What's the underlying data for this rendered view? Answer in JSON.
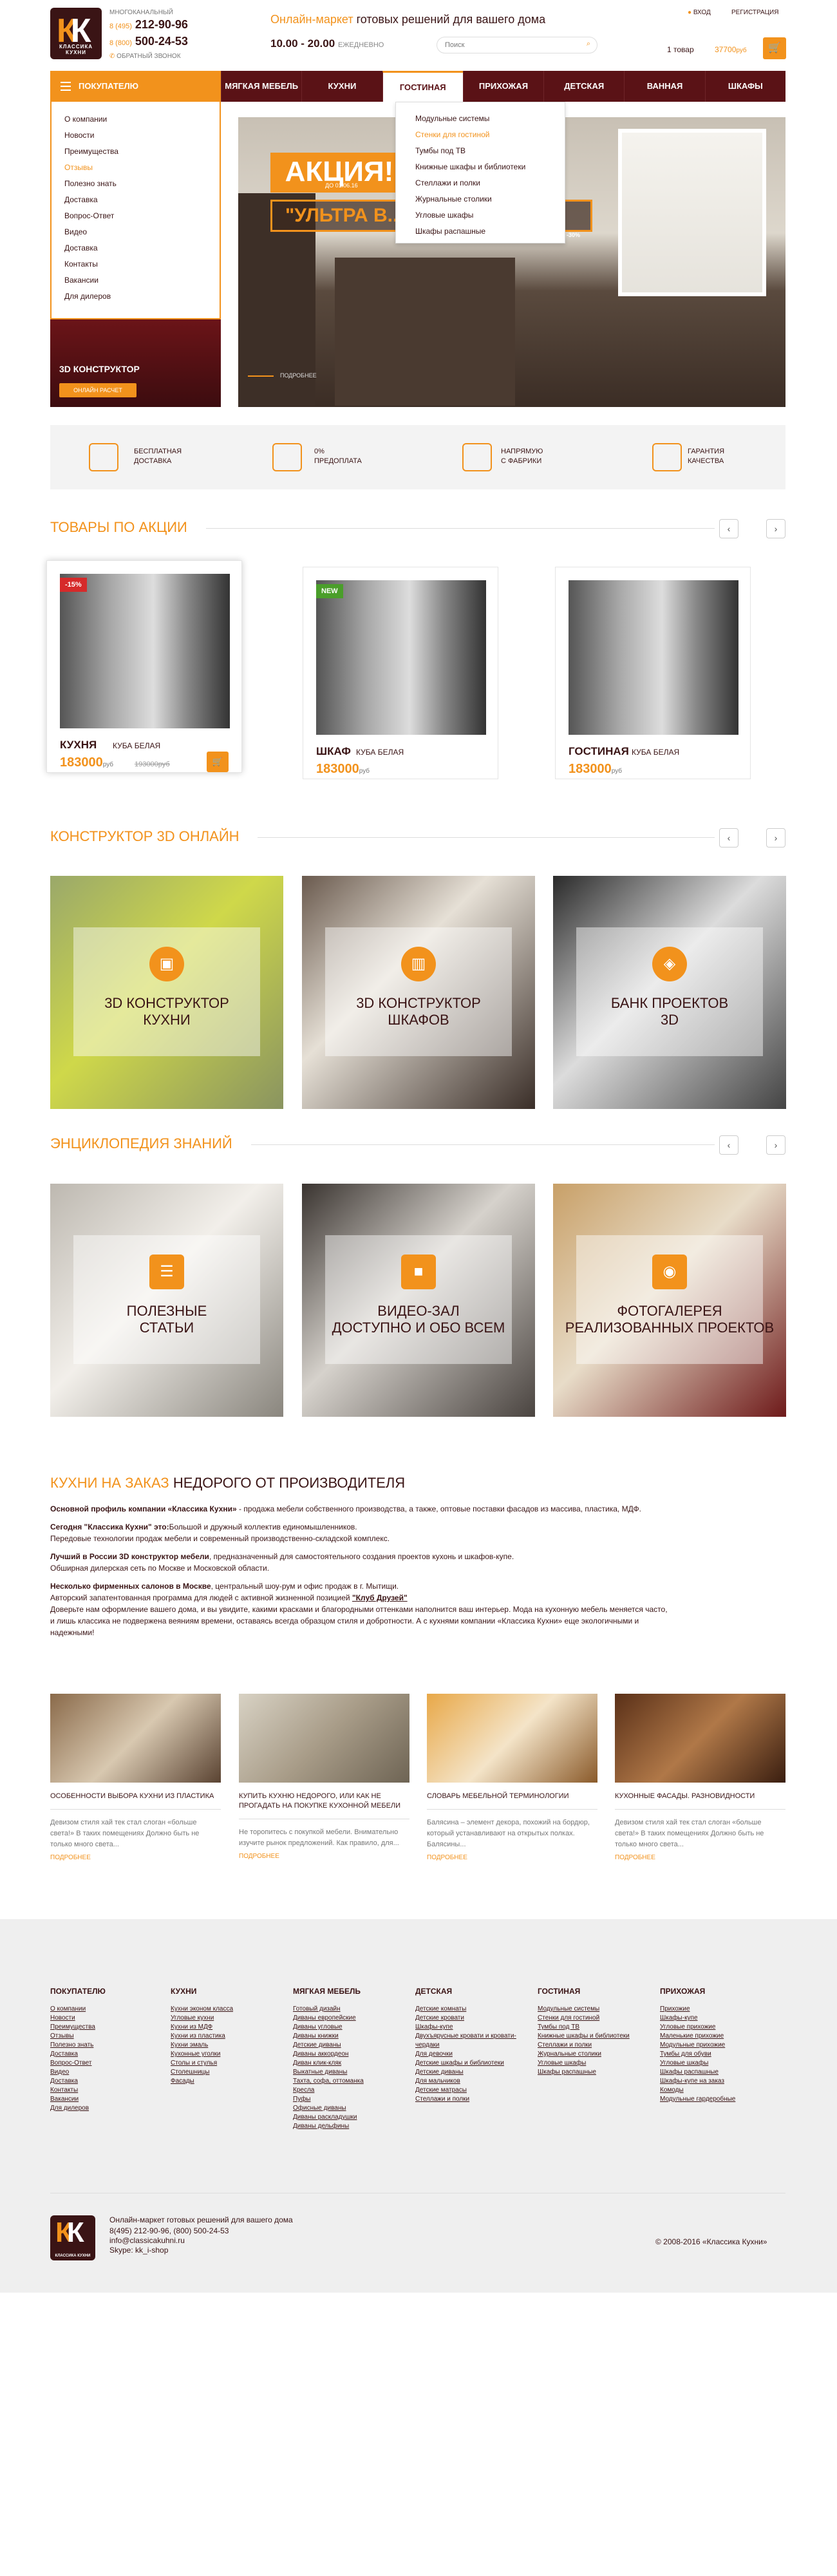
{
  "header": {
    "logo_letters": "К",
    "logo_text": "КЛАССИКА КУХНИ",
    "phone_caption": "МНОГОКАНАЛЬНЫЙ",
    "phone1_prefix": "8 (495)",
    "phone1": "212-90-96",
    "phone2_prefix": "8 (800)",
    "phone2": "500-24-53",
    "callback": "ОБРАТНЫЙ ЗВОНОК",
    "tagline_or": "Онлайн-маркет",
    "tagline_rest": " готовых решений для вашего дома",
    "hours": "10.00 - 20.00",
    "hours_suffix": "ЕЖЕДНЕВНО",
    "search_placeholder": "Поиск",
    "login": "ВХОД",
    "register": "РЕГИСТРАЦИЯ",
    "cart_count": "1 товар",
    "cart_sum": "37700",
    "cart_currency": "руб"
  },
  "nav": {
    "catalog": "ПОКУПАТЕЛЮ",
    "items": [
      "МЯГКАЯ МЕБЕЛЬ",
      "КУХНИ",
      "ГОСТИНАЯ",
      "ПРИХОЖАЯ",
      "ДЕТСКАЯ",
      "ВАННАЯ",
      "ШКАФЫ"
    ]
  },
  "sidemenu": [
    "О компании",
    "Новости",
    "Преимущества",
    "Отзывы",
    "Полезно знать",
    "Доставка",
    "Вопрос-Ответ",
    "Видео",
    "Доставка",
    "Контакты",
    "Вакансии",
    "Для дилеров"
  ],
  "dropdown": [
    "Модульные системы",
    "Стенки для гостиной",
    "Тумбы под ТВ",
    "Книжные шкафы и библиотеки",
    "Стеллажи и полки",
    "Журнальные столики",
    "Угловые шкафы",
    "Шкафы распашные"
  ],
  "hero": {
    "akcia": "АКЦИЯ!",
    "akcia_date": "ДО 01.06.16",
    "ultra": "\"УЛЬТРА В... ...О\"",
    "percent": "-30%",
    "more": "ПОДРОБНЕЕ",
    "constructor": "3D КОНСТРУКТОР",
    "constructor_btn": "ОНЛАЙН РАСЧЕТ"
  },
  "features": [
    {
      "l1": "БЕСПЛАТНАЯ",
      "l2": "ДОСТАВКА"
    },
    {
      "l1": "0%",
      "l2": "ПРЕДОПЛАТА"
    },
    {
      "l1": "НАПРЯМУЮ",
      "l2": "С ФАБРИКИ"
    },
    {
      "l1": "ГАРАНТИЯ",
      "l2": "КАЧЕСТВА"
    }
  ],
  "promo": {
    "title": "ТОВАРЫ ПО АКЦИИ",
    "products": [
      {
        "badge": "-15%",
        "badge_color": "#d62a2a",
        "name": "КУХНЯ",
        "sub": "КУБА БЕЛАЯ",
        "price": "183000",
        "old": "193000руб"
      },
      {
        "badge": "NEW",
        "badge_color": "#4a9e2a",
        "name": "ШКАФ",
        "sub": "КУБА БЕЛАЯ",
        "price": "183000",
        "old": ""
      },
      {
        "badge": "",
        "badge_color": "",
        "name": "ГОСТИНАЯ",
        "sub": "КУБА БЕЛАЯ",
        "price": "183000",
        "old": ""
      }
    ],
    "currency": "руб"
  },
  "constructor": {
    "title": "КОНСТРУКТОР 3D ОНЛАЙН",
    "tiles": [
      {
        "l1": "3D КОНСТРУКТОР",
        "l2": "КУХНИ"
      },
      {
        "l1": "3D КОНСТРУКТОР",
        "l2": "ШКАФОВ"
      },
      {
        "l1": "БАНК ПРОЕКТОВ",
        "l2": "3D"
      }
    ]
  },
  "encyclopedia": {
    "title": "ЭНЦИКЛОПЕДИЯ ЗНАНИЙ",
    "tiles": [
      {
        "l1": "ПОЛЕЗНЫЕ",
        "l2": "СТАТЬИ"
      },
      {
        "l1": "ВИДЕО-ЗАЛ",
        "l2": "Доступно и обо всем"
      },
      {
        "l1": "ФОТОГАЛЕРЕЯ",
        "l2": "реализованных проектов"
      }
    ]
  },
  "about": {
    "title_or": "КУХНИ НА ЗАКАЗ",
    "title_rest": " НЕДОРОГО ОТ ПРОИЗВОДИТЕЛЯ",
    "p1b": "Основной профиль компании «Классика Кухни»",
    "p1": " - продажа мебели собственного производства, а также, оптовые поставки фасадов из массива, пластика, МДФ.",
    "p2b": "Сегодня \"Классика Кухни\" это:",
    "p2": "Большой и дружный коллектив единомышленников.",
    "p3": "Передовые технологии продаж мебели и современный производственно-складской комплекс.",
    "p4b": "Лучший в России 3D конструктор мебели",
    "p4": ", предназначенный для самостоятельного создания проектов кухонь и шкафов-купе.",
    "p5": "Обширная дилерская сеть по Москве и Московской области.",
    "p6b": "Несколько фирменных салонов в Москве",
    "p6": ", центральный шоу-рум и офис продаж в г. Мытищи.",
    "p7": "Авторский запатентованная программа для людей с активной жизненной позицией ",
    "p7b": "\"Клуб Друзей\"",
    "p8": "Доверьте нам оформление вашего дома, и вы увидите, какими красками и благородными оттенками наполнится ваш интерьер. Мода на кухонную мебель меняется часто,",
    "p9": "и лишь классика не подвержена веяниям времени, оставаясь всегда образцом стиля и добротности. А с кухнями компании «Классика Кухни» еще экологичными и",
    "p10": "надежными!"
  },
  "articles": [
    {
      "title": "ОСОБЕННОСТИ ВЫБОРА КУХНИ ИЗ ПЛАСТИКА",
      "desc": "Девизом стиля хай тек стал слоган «больше света!» В таких помещениях Должно быть не только много света...",
      "more": "ПОДРОБНЕЕ"
    },
    {
      "title": "КУПИТЬ КУХНЮ НЕДОРОГО, ИЛИ КАК НЕ ПРОГАДАТЬ НА ПОКУПКЕ КУХОННОЙ МЕБЕЛИ",
      "desc": "Не торопитесь с покупкой мебели. Внимательно изучите рынок предложений. Как правило, для...",
      "more": "ПОДРОБНЕЕ"
    },
    {
      "title": "СЛОВАРЬ МЕБЕЛЬНОЙ ТЕРМИНОЛОГИИ",
      "desc": "Балясина – элемент декора, похожий на бордюр, который устанавливают на открытых полках. Балясины...",
      "more": "ПОДРОБНЕЕ"
    },
    {
      "title": "КУХОННЫЕ ФАСАДЫ. РАЗНОВИДНОСТИ",
      "desc": "Девизом стиля хай тек стал слоган «больше света!» В таких помещениях Должно быть не только много света...",
      "more": "ПОДРОБНЕЕ"
    }
  ],
  "footer": {
    "cols": [
      {
        "h": "ПОКУПАТЕЛЮ",
        "items": [
          "О компании",
          "Новости",
          "Преимущества",
          "Отзывы",
          "Полезно знать",
          "Доставка",
          "Вопрос-Ответ",
          "Видео",
          "Доставка",
          "Контакты",
          "Вакансии",
          "Для дилеров"
        ]
      },
      {
        "h": "КУХНИ",
        "items": [
          "Кухни эконом класса",
          "Угловые кухни",
          "Кухни из МДФ",
          "Кухни из пластика",
          "Кухни эмаль",
          "Кухонные уголки",
          "Столы и стулья",
          "Столешницы",
          "Фасады"
        ]
      },
      {
        "h": "МЯГКАЯ МЕБЕЛЬ",
        "items": [
          "Готовый дизайн",
          "Диваны европейские",
          "Диваны угловые",
          "Диваны книжки",
          "Детские диваны",
          "Диваны аккордеон",
          "Диван клик-кляк",
          "Выкатные диваны",
          "Тахта, софа, оттоманка",
          "Кресла",
          "Пуфы",
          "Офисные диваны",
          "Диваны раскладушки",
          "Диваны дельфины"
        ]
      },
      {
        "h": "ДЕТСКАЯ",
        "items": [
          "Детские комнаты",
          "Детские кровати",
          "Шкафы-купе",
          "Двухъярусные кровати и кровати-чердаки",
          "Для девочки",
          "Детские шкафы и библиотеки",
          "Детские диваны",
          "Для мальчиков",
          "Детские матрасы",
          "Стеллажи и полки"
        ]
      },
      {
        "h": "ГОСТИНАЯ",
        "items": [
          "Модульные системы",
          "Стенки для гостиной",
          "Тумбы под ТВ",
          "Книжные шкафы и библиотеки",
          "Стеллажи и полки",
          "Журнальные столики",
          "Угловые шкафы",
          "Шкафы распашные"
        ]
      },
      {
        "h": "ПРИХОЖАЯ",
        "items": [
          "Прихожие",
          "Шкафы-купе",
          "Угловые прихожие",
          "Маленькие прихожие",
          "Модульные прихожие",
          "Тумбы для обуви",
          "Угловые шкафы",
          "Шкафы распашные",
          "Шкафы-купе на заказ",
          "Комоды",
          "Модульные гардеробные"
        ]
      }
    ],
    "tagline": "Онлайн-маркет готовых решений для вашего дома",
    "phones": "8(495) 212-90-96,   (800) 500-24-53",
    "email": "info@classicakuhni.ru",
    "skype": "Skype: kk_i-shop",
    "copyright": "© 2008-2016 «Классика Кухни»"
  }
}
